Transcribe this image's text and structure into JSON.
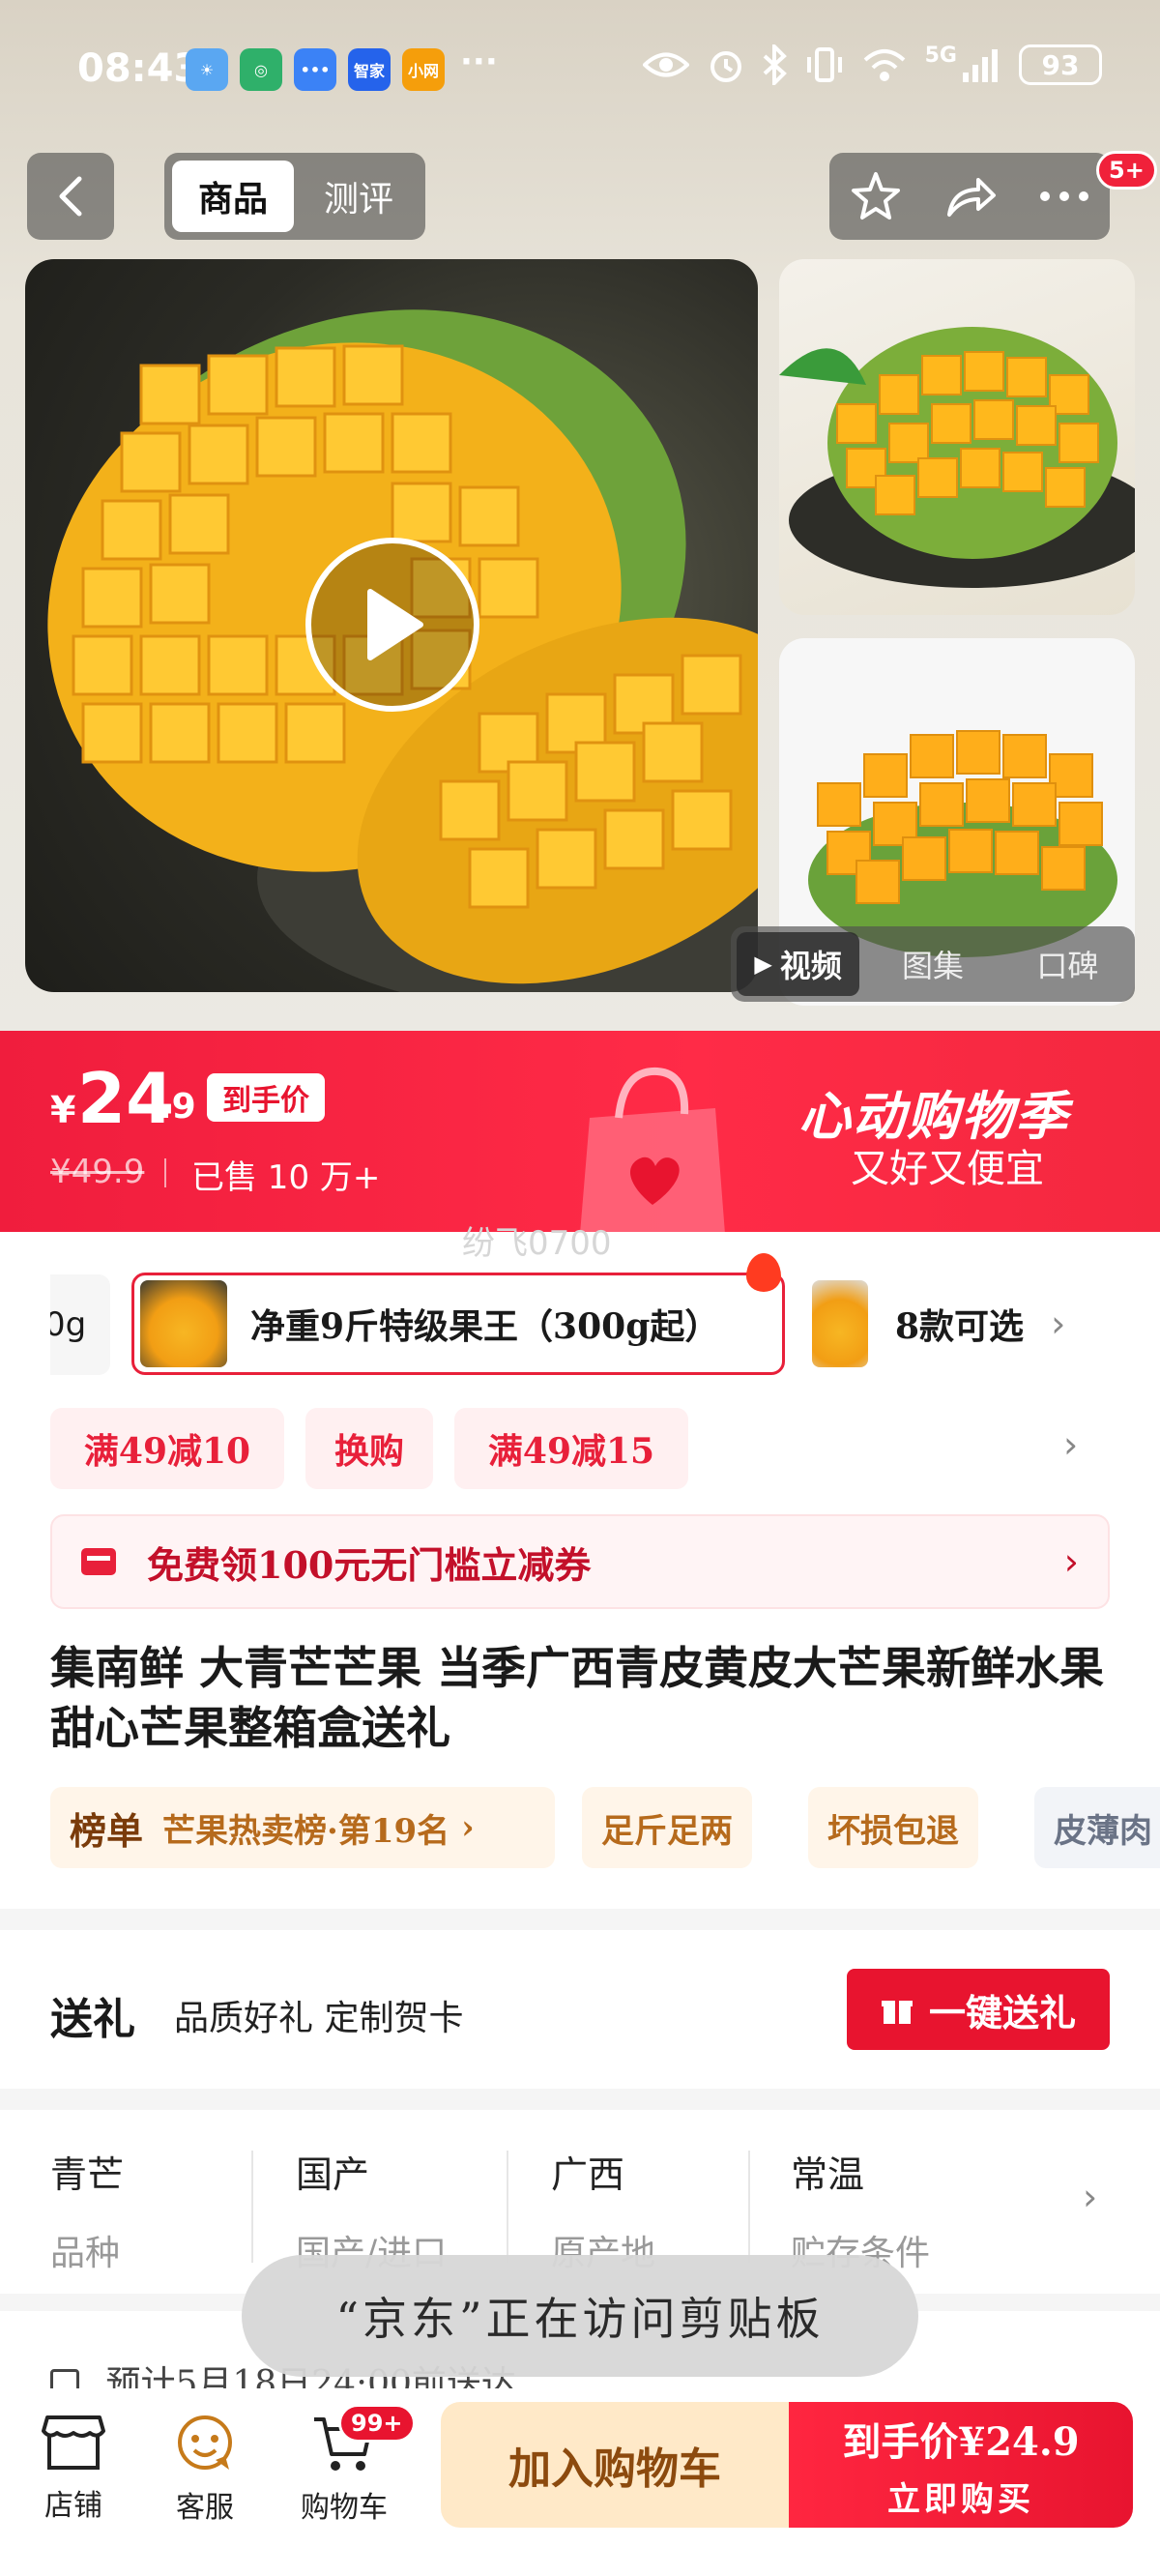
{
  "status_bar": {
    "time": "08:43",
    "apps": [
      "weather-app-icon",
      "mobile-app-icon",
      "messages-app-icon",
      "smarthome-app-icon",
      "xiaomi-app-icon"
    ],
    "smarthome_label": "智家",
    "xiaomi_label": "小网",
    "more": "···",
    "network": "5G",
    "battery": "93"
  },
  "top_nav": {
    "tabs": [
      {
        "label": "商品",
        "active": true
      },
      {
        "label": "测评",
        "active": false
      }
    ],
    "badge": "5+"
  },
  "gallery": {
    "media_tabs": [
      {
        "label": "视频",
        "active": true
      },
      {
        "label": "图集",
        "active": false
      },
      {
        "label": "口碑",
        "active": false
      }
    ]
  },
  "price": {
    "currency": "¥",
    "integer": "24",
    "decimal": ".9",
    "tag": "到手价",
    "original": "¥49.9",
    "sold": "已售 10 万+",
    "promo_title": "心动购物季",
    "promo_subtitle": "又好又便宜",
    "watermark": "纷飞0700"
  },
  "spec": {
    "prev_fragment": "0g",
    "selected": "净重9斤特级果王（300g起）",
    "more": "8款可选"
  },
  "coupons": [
    "满49减10",
    "换购",
    "满49减15"
  ],
  "voucher": "免费领100元无门槛立减券",
  "title": "集南鲜 大青芒芒果 当季广西青皮黄皮大芒果新鲜水果甜心芒果整箱盒送礼",
  "tags": {
    "rank_key": "榜单",
    "rank": "芒果热卖榜·第19名",
    "items": [
      "足斤足两",
      "坏损包退"
    ],
    "cut": "皮薄肉"
  },
  "gift": {
    "title": "送礼",
    "desc": "品质好礼 定制贺卡",
    "button": "一键送礼"
  },
  "attributes": [
    {
      "value": "青芒",
      "key": "品种"
    },
    {
      "value": "国产",
      "key": "国产/进口"
    },
    {
      "value": "广西",
      "key": "原产地"
    },
    {
      "value": "常温",
      "key": "贮存条件"
    }
  ],
  "shipping": "预计5月18日24:00前送达",
  "toast": "“京东”正在访问剪贴板",
  "bottom_bar": {
    "shop": "店铺",
    "service": "客服",
    "cart": "购物车",
    "cart_badge": "99+",
    "add_to_cart": "加入购物车",
    "buy_price_label": "到手价¥24.9",
    "buy_now": "立即购买"
  },
  "colors": {
    "brand_red": "#e8142f",
    "cart_bg": "#ffe9c8",
    "cart_text": "#8c4a0e"
  }
}
